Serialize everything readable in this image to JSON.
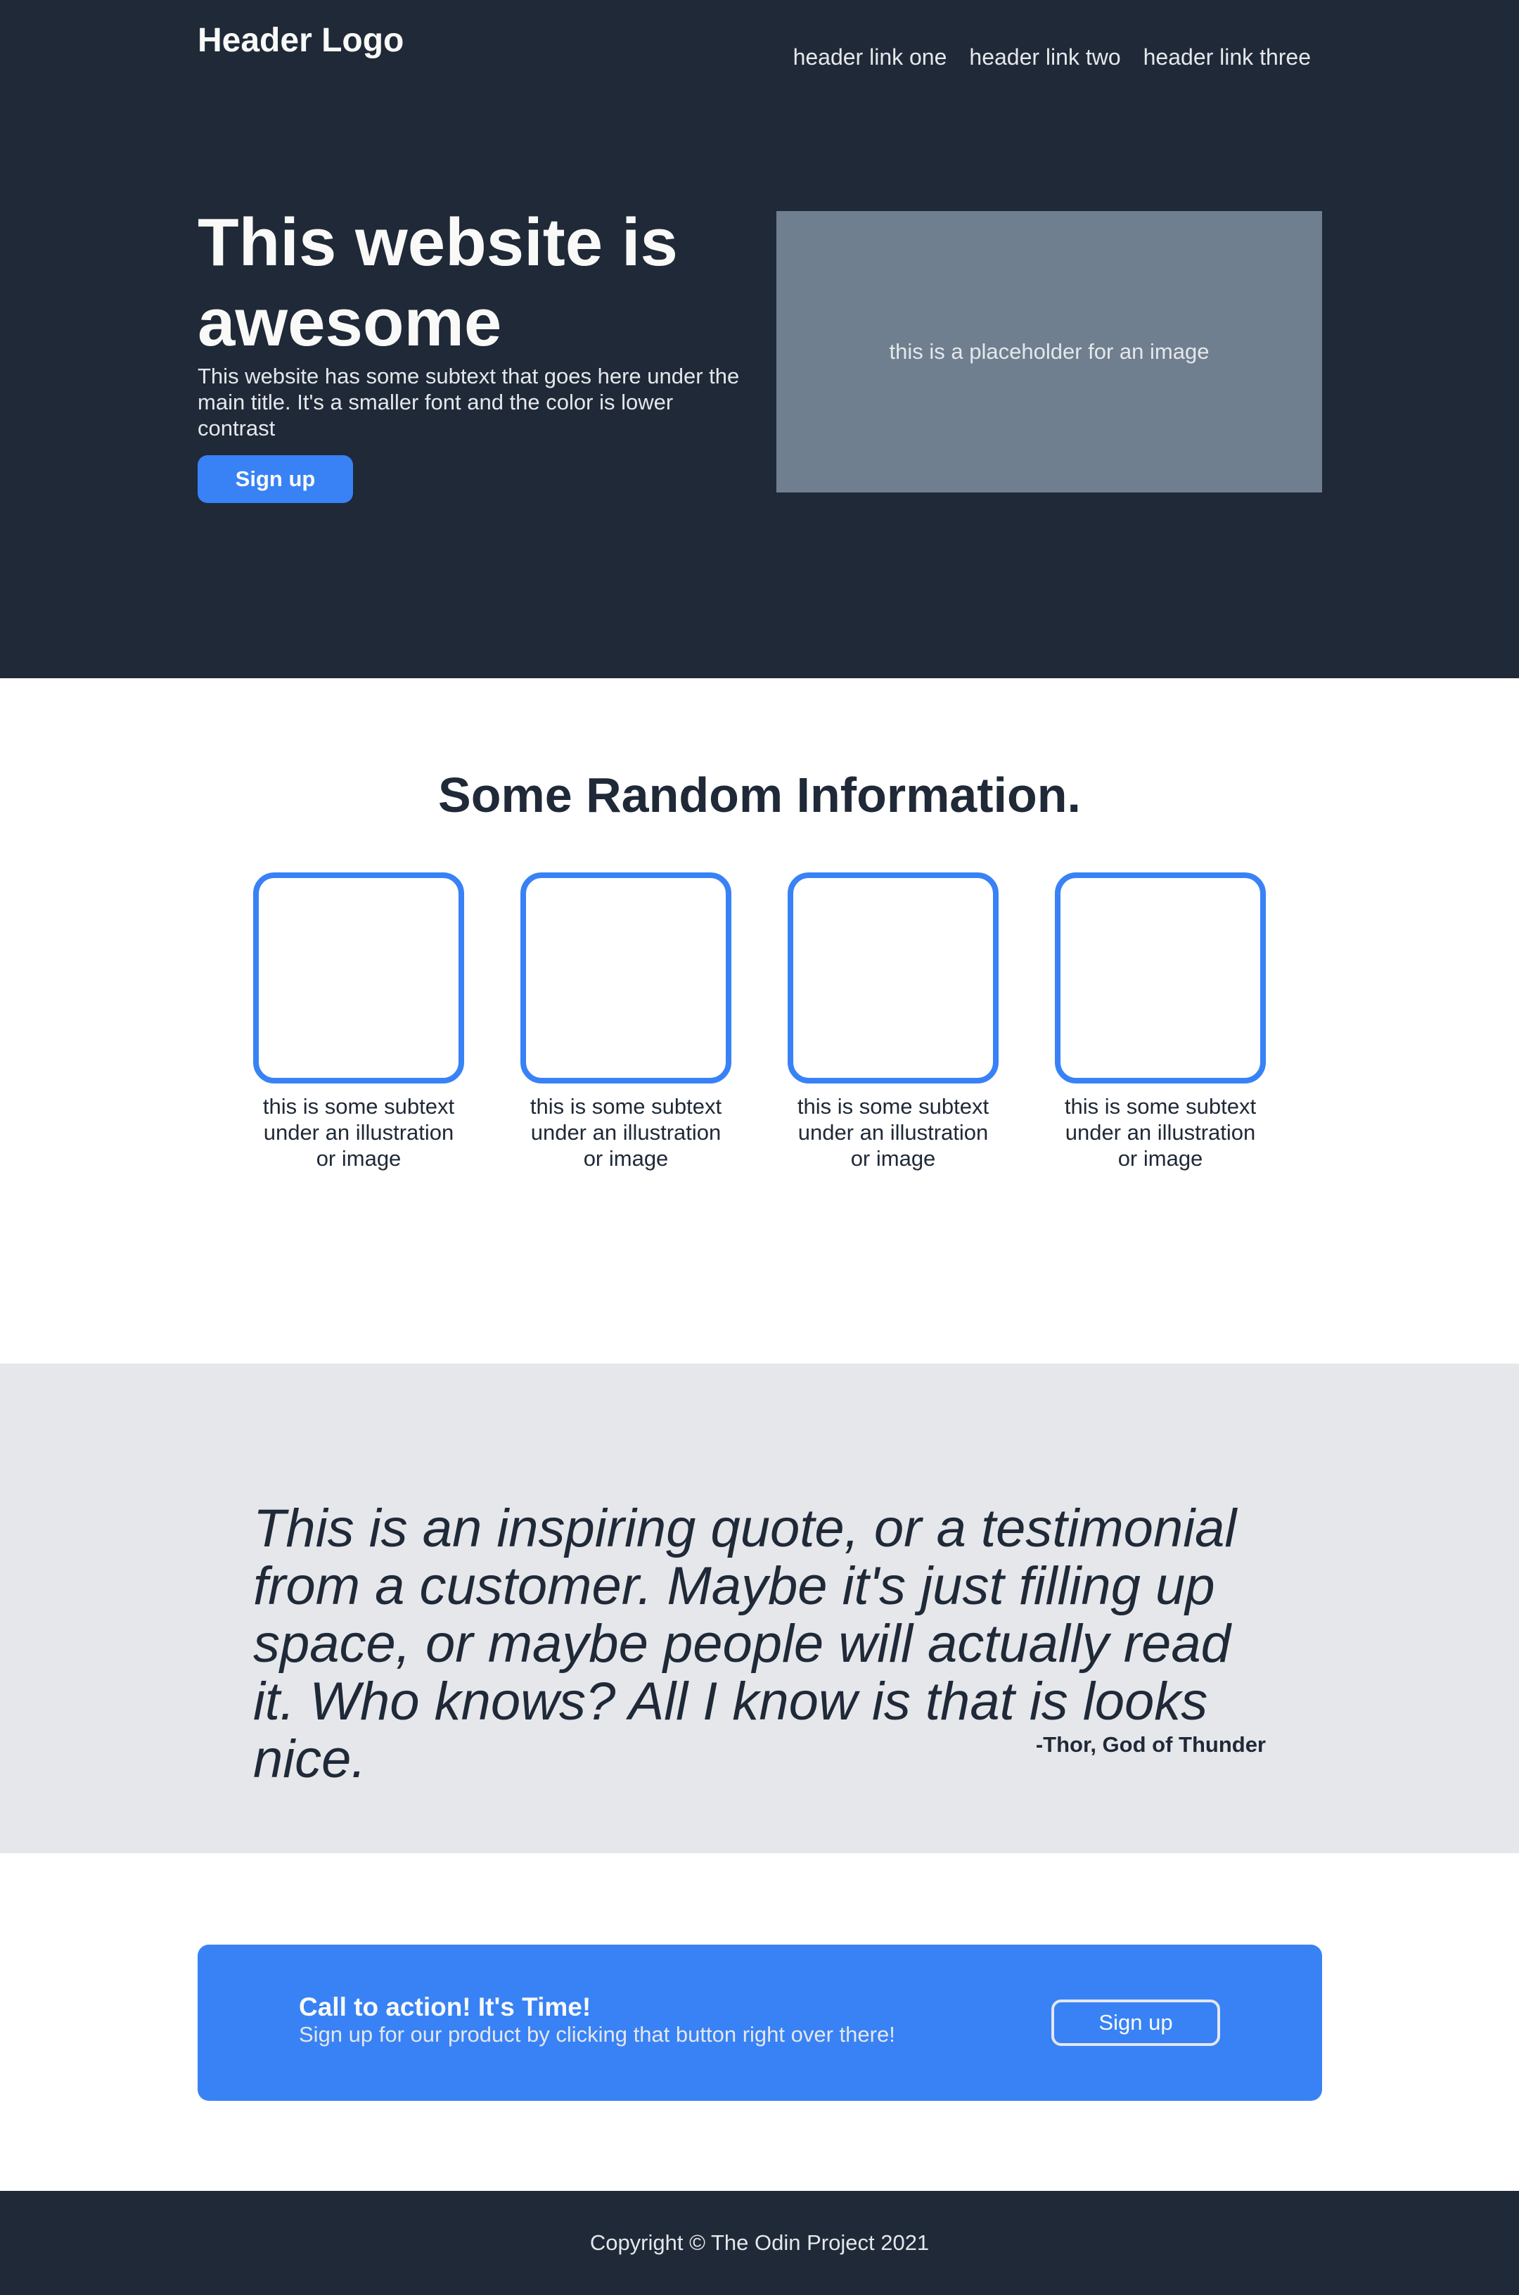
{
  "header": {
    "logo": "Header Logo",
    "links": [
      "header link one",
      "header link two",
      "header link three"
    ]
  },
  "hero": {
    "title": "This website is awesome",
    "subtext": "This website has some subtext that goes here under the main title. It's a smaller font and the color is lower contrast",
    "button_label": "Sign up",
    "image_placeholder": "this is a placeholder for an image"
  },
  "info": {
    "title": "Some Random Information.",
    "cards": [
      {
        "text": "this is some subtext under an illustration or image"
      },
      {
        "text": "this is some subtext under an illustration or image"
      },
      {
        "text": "this is some subtext under an illustration or image"
      },
      {
        "text": "this is some subtext under an illustration or image"
      }
    ]
  },
  "quote": {
    "text": "This is an inspiring quote, or a testimonial from a customer. Maybe it's just filling up space, or maybe people will actually read it. Who knows? All I know is that is looks nice.",
    "author": "-Thor, God of Thunder"
  },
  "cta": {
    "title": "Call to action! It's Time!",
    "subtext": "Sign up for our product by clicking that button right over there!",
    "button_label": "Sign up"
  },
  "footer": {
    "copyright": "Copyright © The Odin Project 2021"
  },
  "colors": {
    "dark": "#1f2937",
    "accent": "#3882f6",
    "light_text": "#f9faf8",
    "muted_text": "#e5e7eb",
    "quote_bg": "#e5e7eb",
    "image_placeholder_bg": "#6f7f8f"
  }
}
